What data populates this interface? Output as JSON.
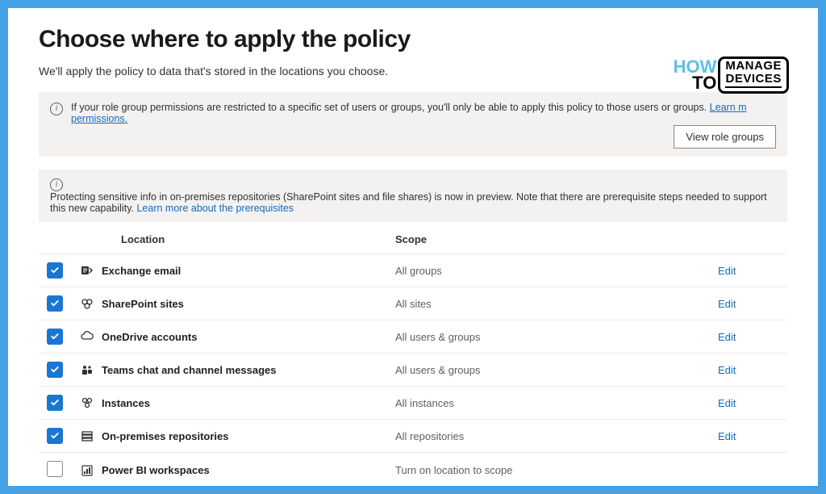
{
  "page": {
    "title": "Choose where to apply the policy",
    "subtitle": "We'll apply the policy to data that's stored in the locations you choose."
  },
  "banner1": {
    "text": "If your role group permissions are restricted to a specific set of users or groups, you'll only be able to apply this policy to those users or groups.  ",
    "link1": "Learn m",
    "link2": "permissions.",
    "button": "View role groups"
  },
  "banner2": {
    "text": "Protecting sensitive info in on-premises repositories (SharePoint sites and file shares) is now in preview. Note that there are prerequisite steps needed to support this new capability.  ",
    "link": "Learn more about the prerequisites"
  },
  "headers": {
    "location": "Location",
    "scope": "Scope"
  },
  "rows": [
    {
      "checked": true,
      "icon": "exchange",
      "name": "Exchange email",
      "scope": "All groups",
      "action": "Edit"
    },
    {
      "checked": true,
      "icon": "sharepoint",
      "name": "SharePoint sites",
      "scope": "All sites",
      "action": "Edit"
    },
    {
      "checked": true,
      "icon": "onedrive",
      "name": "OneDrive accounts",
      "scope": "All users & groups",
      "action": "Edit"
    },
    {
      "checked": true,
      "icon": "teams",
      "name": "Teams chat and channel messages",
      "scope": "All users & groups",
      "action": "Edit"
    },
    {
      "checked": true,
      "icon": "instances",
      "name": "Instances",
      "scope": "All instances",
      "action": "Edit"
    },
    {
      "checked": true,
      "icon": "onprem",
      "name": "On-premises repositories",
      "scope": "All repositories",
      "action": "Edit"
    },
    {
      "checked": false,
      "icon": "powerbi",
      "name": "Power BI workspaces",
      "scope": "Turn on location to scope",
      "action": ""
    }
  ],
  "logo": {
    "how": "HOW",
    "to": "TO",
    "manage": "MANAGE",
    "devices": "DEVICES"
  }
}
